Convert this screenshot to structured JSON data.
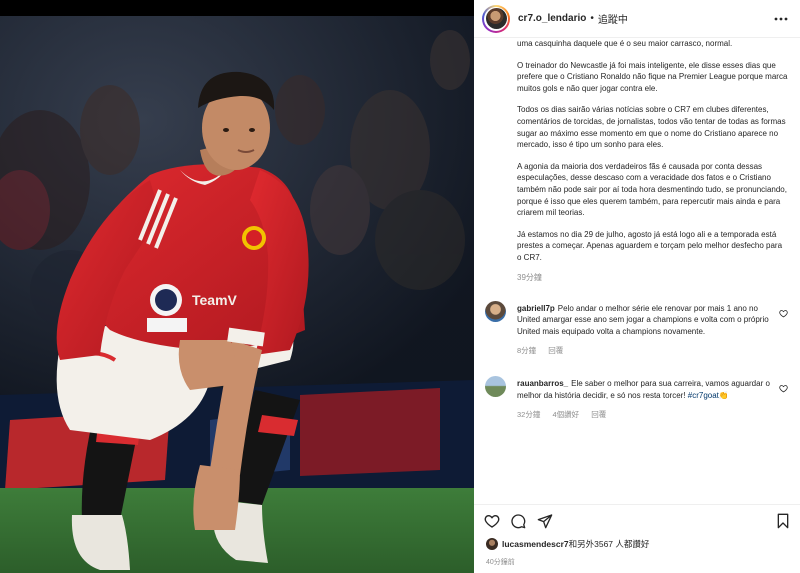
{
  "header": {
    "username": "cr7.o_lendario",
    "separator": "•",
    "follow_status": "追蹤中",
    "more_icon": "more-horizontal-icon"
  },
  "caption": {
    "paragraphs": [
      "uma casquinha daquele que é o seu maior carrasco, normal.",
      "O treinador do Newcastle já foi mais inteligente, ele disse esses dias que prefere que o Cristiano Ronaldo não fique na Premier League porque marca muitos gols e não quer jogar contra ele.",
      "Todos os dias sairão várias notícias sobre o CR7 em clubes diferentes, comentários de torcidas, de jornalistas, todos vão tentar de todas as formas sugar ao máximo esse momento em que o nome do Cristiano aparece no mercado, isso é tipo um sonho para eles.",
      "A agonia da maioria dos verdadeiros fãs é causada por conta dessas especulações, desse descaso com a veracidade dos fatos e o Cristiano também não pode sair por aí toda hora desmentindo tudo, se pronunciando, porque é isso que eles querem também, para repercutir mais ainda e para criarem mil teorias.",
      "Já estamos no dia 29 de julho, agosto já está logo ali e a temporada está prestes a começar. Apenas aguardem e torçam pelo melhor desfecho para o CR7."
    ],
    "time": "39分鐘"
  },
  "comments": [
    {
      "username": "gabriell7p",
      "text": "Pelo andar o melhor série ele renovar por mais 1 ano no United amargar esse ano sem jogar a champions e volta com o próprio United mais equipado volta a champions novamente.",
      "hashtag": "",
      "time": "8分鐘",
      "likes": "",
      "reply": "回覆"
    },
    {
      "username": "rauanbarros_",
      "text": "Ele saber o melhor para sua carreira, vamos aguardar o melhor da história decidir, e só nos resta torcer!",
      "hashtag": "#cr7goat",
      "hashtag_emoji": "👏",
      "time": "32分鐘",
      "likes": "4個讚好",
      "reply": "回覆"
    }
  ],
  "actions": {
    "like_icon": "heart-icon",
    "comment_icon": "comment-icon",
    "share_icon": "share-icon",
    "save_icon": "bookmark-icon"
  },
  "likes": {
    "user": "lucasmendescr7",
    "text": "和另外3567 人都讚好"
  },
  "post_age": "40分鐘前",
  "colors": {
    "jersey_red": "#d41f26",
    "link_blue": "#00376b",
    "muted": "#8e8e8e"
  }
}
